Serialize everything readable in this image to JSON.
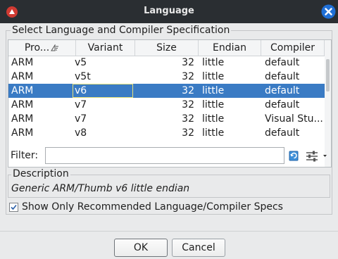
{
  "window": {
    "title": "Language"
  },
  "group_label": "Select Language and Compiler Specification",
  "table": {
    "columns": [
      "Pro...",
      "Variant",
      "Size",
      "Endian",
      "Compiler"
    ],
    "rows": [
      {
        "processor": "ARM",
        "variant": "v5",
        "size": "32",
        "endian": "little",
        "compiler": "default"
      },
      {
        "processor": "ARM",
        "variant": "v5t",
        "size": "32",
        "endian": "little",
        "compiler": "default"
      },
      {
        "processor": "ARM",
        "variant": "v6",
        "size": "32",
        "endian": "little",
        "compiler": "default"
      },
      {
        "processor": "ARM",
        "variant": "v7",
        "size": "32",
        "endian": "little",
        "compiler": "default"
      },
      {
        "processor": "ARM",
        "variant": "v7",
        "size": "32",
        "endian": "little",
        "compiler": "Visual Stu..."
      },
      {
        "processor": "ARM",
        "variant": "v8",
        "size": "32",
        "endian": "little",
        "compiler": "default"
      }
    ],
    "selected_row_index": 2
  },
  "filter": {
    "label": "Filter:",
    "value": ""
  },
  "description": {
    "label": "Description",
    "text": "Generic ARM/Thumb v6 little endian"
  },
  "recommended_checkbox": {
    "label": "Show Only Recommended Language/Compiler Specs",
    "checked": true
  },
  "buttons": {
    "ok": "OK",
    "cancel": "Cancel"
  },
  "colors": {
    "titlebar": "#2a2e32",
    "selection": "#3a7bc4",
    "close_button": "#1f6fd6",
    "app_icon": "#d03a32"
  }
}
